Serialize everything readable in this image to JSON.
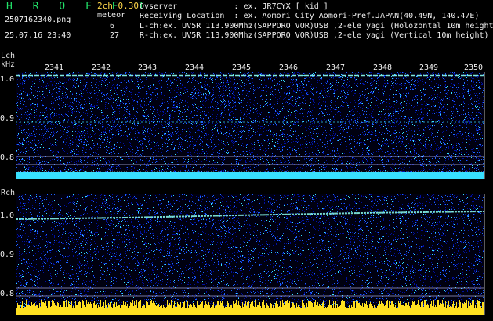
{
  "header": {
    "logo": "H R O F F T",
    "mode": "2ch 0.30",
    "meteor_label": "meteor",
    "filename": "2507162340.png",
    "datetime": "25.07.16 23:40",
    "lch_count": "6",
    "rch_count": "27",
    "info": [
      "Ovserver            : ex. JR7CYX [ kid ]",
      "Receiving Location  : ex. Aomori City Aomori-Pref.JAPAN(40.49N, 140.47E)",
      "L-ch:ex. UV5R 113.900Mhz(SAPPORO VOR)USB ,2-ele yagi (Holozontal 10m height)",
      "R-ch:ex. UV5R 113.900Mhz(SAPPORO VOR)USB ,2-ele yagi (Vertical 10m height)"
    ]
  },
  "lch": {
    "label": "Lch",
    "unit": "kHz",
    "ticks": [
      "1.0",
      "0.9",
      "0.8"
    ]
  },
  "rch": {
    "label": "Rch",
    "ticks": [
      "1.0",
      "0.9",
      "0.8"
    ]
  },
  "time_axis": [
    "2341",
    "2342",
    "2343",
    "2344",
    "2345",
    "2346",
    "2347",
    "2348",
    "2349",
    "2350"
  ],
  "colors": {
    "background": "#000000",
    "logo": "#22e36a",
    "mode": "#ffd84a",
    "noise_low": "#0010a0",
    "noise_mid": "#1e64ff",
    "noise_high": "#38e0ff",
    "strong_signal": "#ffe020",
    "carrier": "#8cfff0"
  }
}
